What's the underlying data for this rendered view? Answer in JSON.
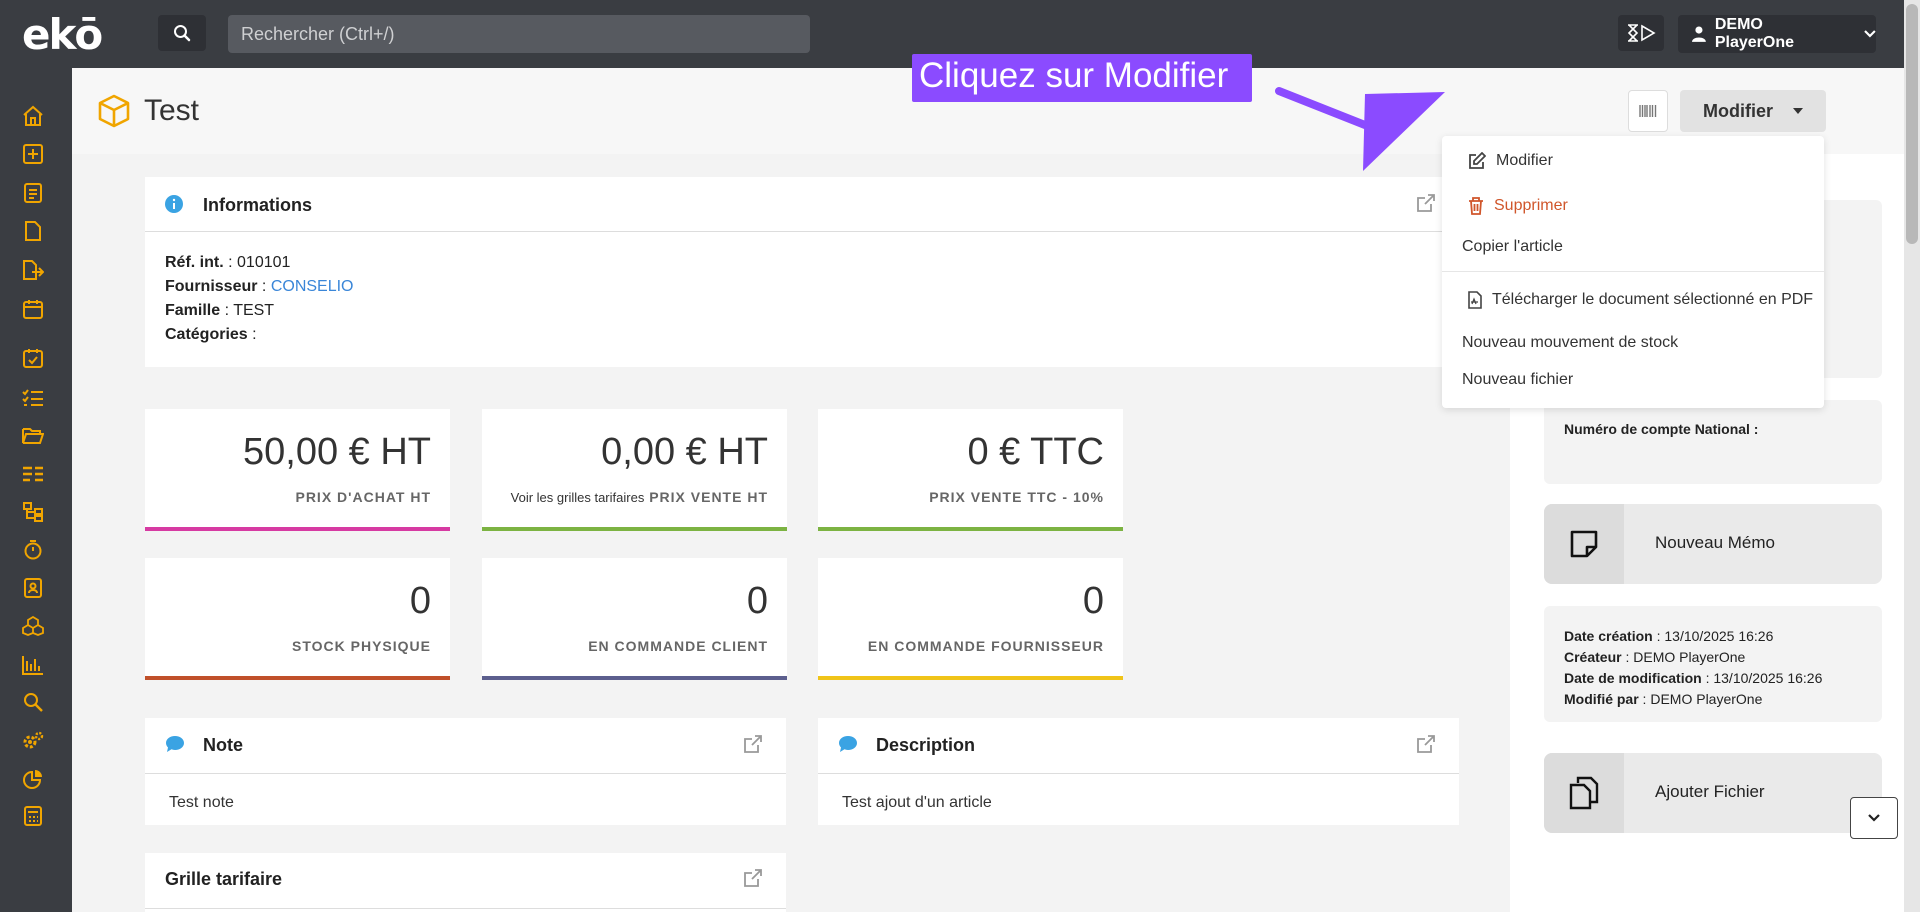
{
  "app": {
    "logo": "ekō"
  },
  "topbar": {
    "search_placeholder": "Rechercher (Ctrl+/)",
    "user_name": "DEMO PlayerOne"
  },
  "page": {
    "title": "Test"
  },
  "toolbar": {
    "modifier_label": "Modifier"
  },
  "tooltip": {
    "text": "Cliquez sur Modifier"
  },
  "dropdown": {
    "items": [
      {
        "label": "Modifier",
        "icon": "edit-icon"
      },
      {
        "label": "Supprimer",
        "icon": "trash-icon",
        "color": "#d0562b"
      },
      {
        "label": "Copier l'article"
      },
      {
        "label": "Télécharger le document sélectionné en PDF",
        "icon": "pdf-icon"
      },
      {
        "label": "Nouveau mouvement de stock"
      },
      {
        "label": "Nouveau fichier"
      }
    ]
  },
  "informations": {
    "title": "Informations",
    "ref_label": "Réf. int.",
    "ref_value": "010101",
    "fournisseur_label": "Fournisseur",
    "fournisseur_value": "CONSELIO",
    "famille_label": "Famille",
    "famille_value": "TEST",
    "categories_label": "Catégories"
  },
  "kpis": [
    {
      "value": "50,00 € HT",
      "label": "PRIX D'ACHAT HT",
      "color": "#d63aa2"
    },
    {
      "value": "0,00 € HT",
      "prefix": "Voir les grilles tarifaires",
      "label": "PRIX VENTE HT",
      "color": "#7cb342"
    },
    {
      "value": "0 € TTC",
      "label": "PRIX VENTE TTC - 10%",
      "color": "#7cb342"
    },
    {
      "value": "0",
      "label": "STOCK PHYSIQUE",
      "color": "#c0502a"
    },
    {
      "value": "0",
      "label": "EN COMMANDE CLIENT",
      "color": "#5c5f8e"
    },
    {
      "value": "0",
      "label": "EN COMMANDE FOURNISSEUR",
      "color": "#f0c419"
    }
  ],
  "note": {
    "title": "Note",
    "body": "Test note"
  },
  "description": {
    "title": "Description",
    "body": "Test ajout d'un article"
  },
  "grille": {
    "title": "Grille tarifaire"
  },
  "right": {
    "compte_label": "Numéro de compte National :",
    "memo_label": "Nouveau Mémo",
    "date_creation_label": "Date création",
    "date_creation": "13/10/2025 16:26",
    "createur_label": "Créateur",
    "createur": "DEMO PlayerOne",
    "date_modif_label": "Date de modification",
    "date_modif": "13/10/2025 16:26",
    "modifie_par_label": "Modifié par",
    "modifie_par": "DEMO PlayerOne",
    "fichier_label": "Ajouter Fichier"
  },
  "colors": {
    "accent": "#f0a500",
    "tooltip": "#8b4bff",
    "info": "#3aa3e3"
  }
}
